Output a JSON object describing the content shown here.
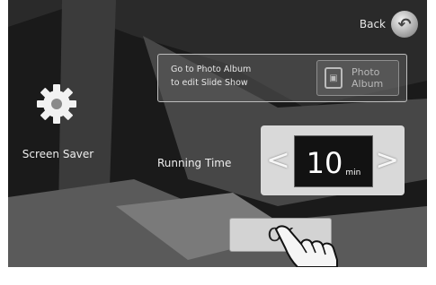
{
  "header": {
    "back_label": "Back",
    "back_icon": "back-arrow-icon"
  },
  "photo_album": {
    "line1": "Go to Photo Album",
    "line2": "to edit Slide Show",
    "button_line1": "Photo",
    "button_line2": "Album",
    "icon": "photo-album-icon"
  },
  "screen_saver": {
    "label": "Screen Saver",
    "icon": "gear-icon"
  },
  "running_time": {
    "label": "Running Time",
    "value": "10",
    "unit": "min",
    "decrement_glyph": "<",
    "increment_glyph": ">"
  },
  "ok_button": {
    "label": "OK"
  },
  "colors": {
    "screen_bg": "#1a1a1a",
    "panel_gray": "#d9d9d9",
    "text_light": "#eeeeee"
  }
}
